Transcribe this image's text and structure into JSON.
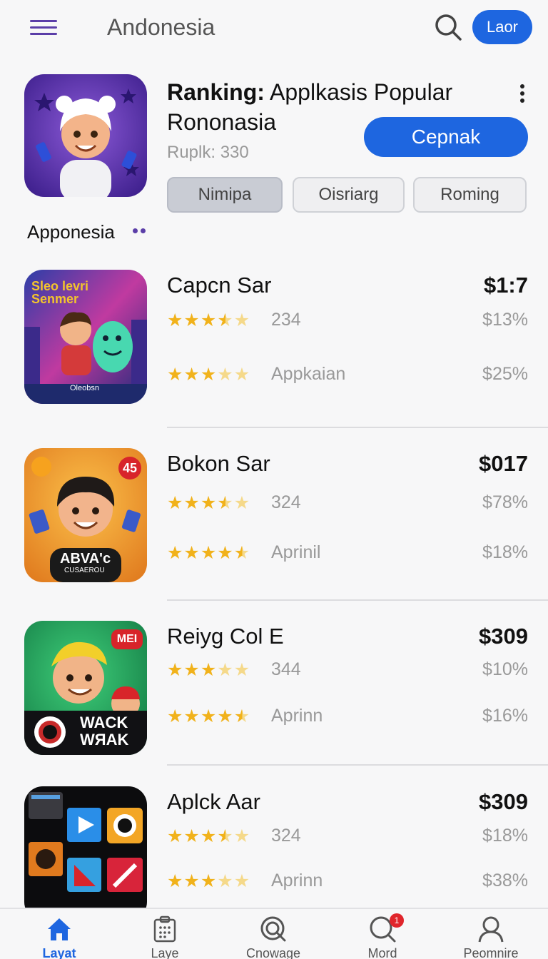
{
  "header": {
    "title": "Andonesia",
    "login_label": "Laor"
  },
  "featured": {
    "title_bold": "Ranking:",
    "title_rest": " Applkasis Popular Rononasia",
    "subtitle": "Ruplk: 330",
    "cta_label": "Cepnak",
    "chips": [
      {
        "label": "Nimipa",
        "selected": true
      },
      {
        "label": "Oisriarg",
        "selected": false
      },
      {
        "label": "Roming",
        "selected": false
      }
    ]
  },
  "section": {
    "label": "Apponesia"
  },
  "apps": [
    {
      "name": "Capcn Sar",
      "price": "$1:7",
      "stars_row1": 3.5,
      "meta1": "234",
      "pct1": "$13%",
      "stars_row2": 3,
      "meta2": "Appkaian",
      "pct2": "$25%",
      "icon_text_top": "Sleo levri Senmer",
      "icon_text_bottom": "Oleobsn"
    },
    {
      "name": "Bokon Sar",
      "price": "$017",
      "stars_row1": 3.5,
      "meta1": "324",
      "pct1": "$78%",
      "stars_row2": 4.5,
      "meta2": "Aprinil",
      "pct2": "$18%",
      "icon_badge": "45",
      "icon_text_top": "ABVA'c",
      "icon_text_bottom": "CUSAEROU"
    },
    {
      "name": "Reiyg Col E",
      "price": "$309",
      "stars_row1": 3,
      "meta1": "344",
      "pct1": "$10%",
      "stars_row2": 4.5,
      "meta2": "Aprinn",
      "pct2": "$16%",
      "icon_badge": "MEI",
      "icon_text_top": "WACK",
      "icon_text_bottom": "WЯAK"
    },
    {
      "name": "Aplck Aar",
      "price": "$309",
      "stars_row1": 3.5,
      "meta1": "324",
      "pct1": "$18%",
      "stars_row2": 3,
      "meta2": "Aprinn",
      "pct2": "$38%"
    }
  ],
  "bottom_nav": [
    {
      "label": "Layat",
      "icon": "home-icon",
      "active": true
    },
    {
      "label": "Laye",
      "icon": "calendar-icon",
      "active": false
    },
    {
      "label": "Cnowage",
      "icon": "search-icon",
      "active": false
    },
    {
      "label": "Mord",
      "icon": "search-icon",
      "active": false,
      "badge": "1"
    },
    {
      "label": "Peomnire",
      "icon": "profile-icon",
      "active": false
    }
  ],
  "colors": {
    "accent": "#1e66e0",
    "brand_purple": "#5b3ea8",
    "star": "#f1b21b",
    "badge": "#e0252b"
  }
}
